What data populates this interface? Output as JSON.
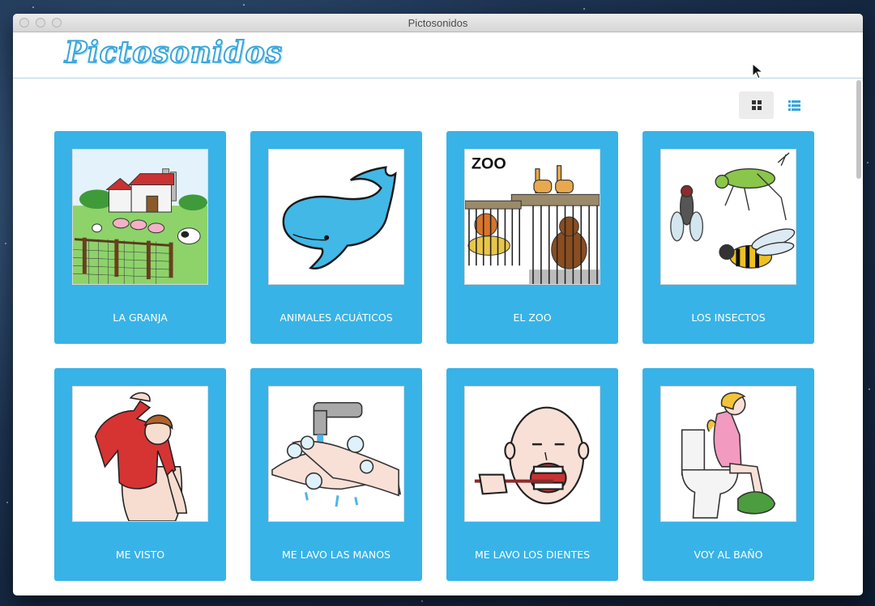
{
  "window": {
    "title": "Pictosonidos"
  },
  "header": {
    "logo_text": "Pictosonidos"
  },
  "view_toggle": {
    "grid_icon": "grid-view-icon",
    "list_icon": "list-view-icon",
    "active": "grid"
  },
  "colors": {
    "card": "#38b3e7",
    "accent": "#3aa6d9"
  },
  "cards": [
    {
      "label": "LA GRANJA",
      "icon": "farm-picture"
    },
    {
      "label": "ANIMALES ACUÁTICOS",
      "icon": "whale-picture"
    },
    {
      "label": "EL ZOO",
      "icon": "zoo-picture",
      "picture_text": "ZOO"
    },
    {
      "label": "LOS INSECTOS",
      "icon": "insects-picture"
    },
    {
      "label": "ME VISTO",
      "icon": "getting-dressed-picture"
    },
    {
      "label": "ME LAVO LAS MANOS",
      "icon": "washing-hands-picture"
    },
    {
      "label": "ME LAVO LOS DIENTES",
      "icon": "brushing-teeth-picture"
    },
    {
      "label": "VOY AL BAÑO",
      "icon": "toilet-picture"
    }
  ]
}
